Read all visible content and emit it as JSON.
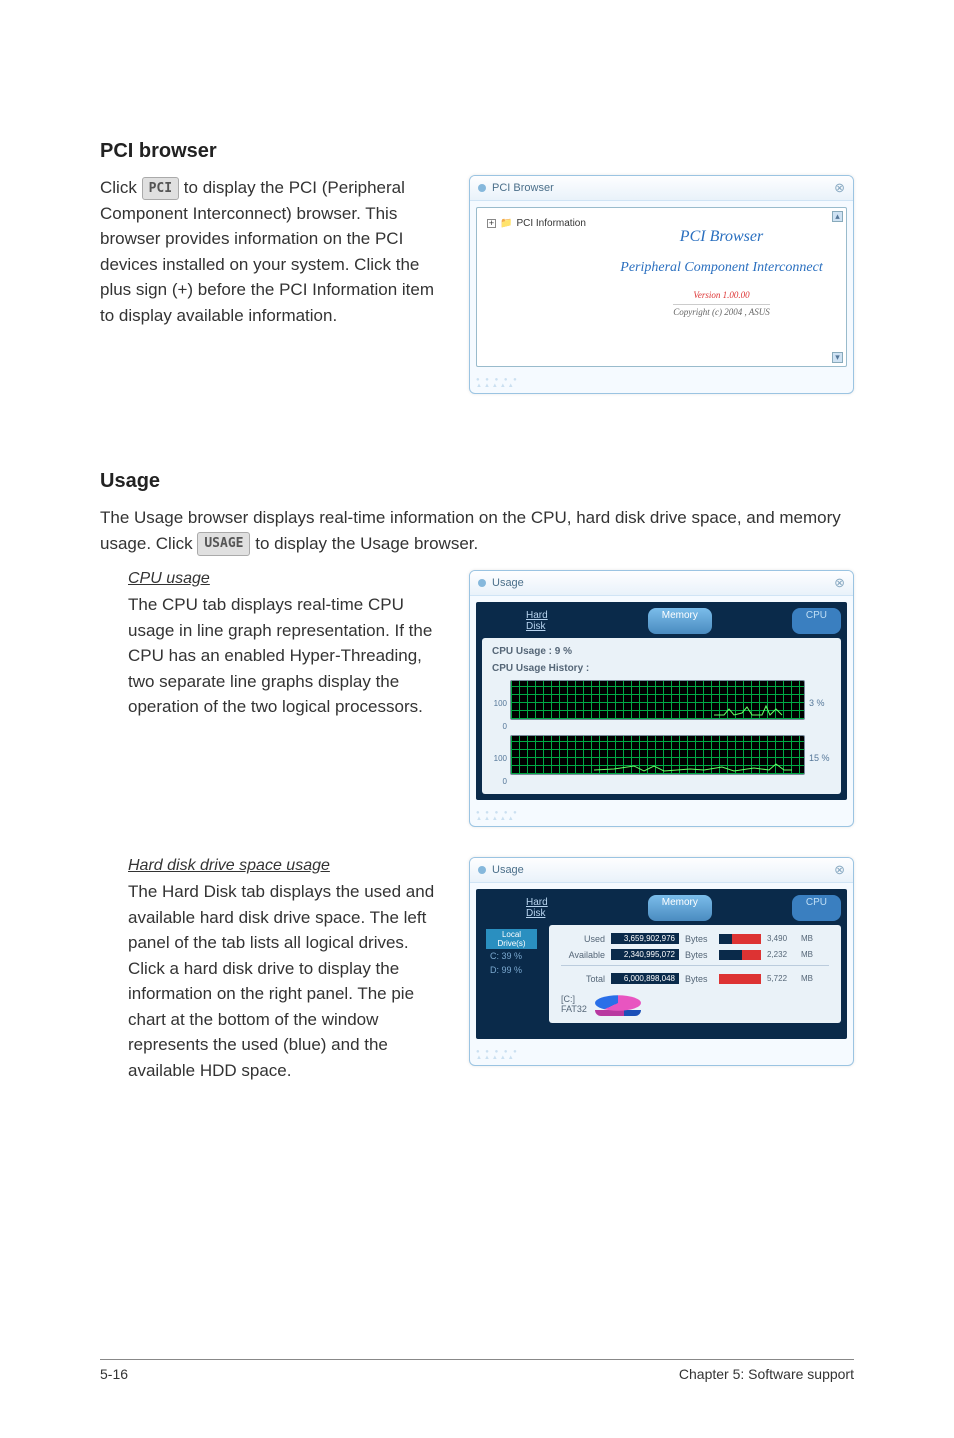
{
  "sections": {
    "pci": {
      "heading": "PCI browser",
      "body": "to display the PCI (Peripheral Component Interconnect) browser. This browser provides information on the PCI devices installed on your system. Click the plus sign (+) before the PCI Information item to display available information.",
      "click": "Click",
      "btn": "PCI"
    },
    "usage": {
      "heading": "Usage",
      "intro1": "The Usage browser displays real-time information on the CPU, hard disk drive space, and memory usage. Click",
      "intro2": "to display the Usage browser.",
      "btn": "USAGE",
      "cpu": {
        "subhead": "CPU usage",
        "body": "The CPU tab displays real-time CPU usage in line graph representation. If the CPU has an enabled Hyper-Threading, two separate line graphs display the operation of the two logical processors."
      },
      "hdd": {
        "subhead": "Hard disk drive space usage",
        "body": "The Hard Disk tab displays the used and available hard disk drive space. The left panel of the tab lists all logical drives. Click a hard disk drive to display the information on the right panel. The pie chart at the bottom of the window represents the used (blue) and the available HDD space."
      }
    }
  },
  "pciWindow": {
    "title": "PCI Browser",
    "tree": "PCI Information",
    "h1": "PCI  Browser",
    "h2": "Peripheral Component Interconnect",
    "version": "Version 1.00.00",
    "copyright": "Copyright (c) 2004 ,  ASUS"
  },
  "cpuWindow": {
    "title": "Usage",
    "tabs": {
      "hard": "Hard Disk",
      "mem": "Memory",
      "cpu": "CPU"
    },
    "line1": "CPU Usage :      9   %",
    "line2": "CPU Usage History :",
    "axis_top": "100",
    "axis_bot": "0",
    "pct1": "3 %",
    "pct2": "15 %"
  },
  "hddWindow": {
    "title": "Usage",
    "tabs": {
      "hard": "Hard Disk",
      "mem": "Memory",
      "cpu": "CPU"
    },
    "drivesHdr": "Local Drive(s)",
    "drive_c": "C:  39 %",
    "drive_d": "D:  99 %",
    "rows": {
      "used": {
        "lbl": "Used",
        "bytes": "3,659,902,976",
        "unit": "Bytes",
        "mb": "3,490",
        "mbunit": "MB",
        "fillpct": 70
      },
      "avail": {
        "lbl": "Available",
        "bytes": "2,340,995,072",
        "unit": "Bytes",
        "mb": "2,232",
        "mbunit": "MB",
        "fillpct": 46
      },
      "total": {
        "lbl": "Total",
        "bytes": "6,000,898,048",
        "unit": "Bytes",
        "mb": "5,722",
        "mbunit": "MB",
        "fillpct": 100
      }
    },
    "pie_drive": "[C:]",
    "pie_fs": "FAT32"
  },
  "footer": {
    "left": "5-16",
    "right": "Chapter 5: Software support"
  }
}
